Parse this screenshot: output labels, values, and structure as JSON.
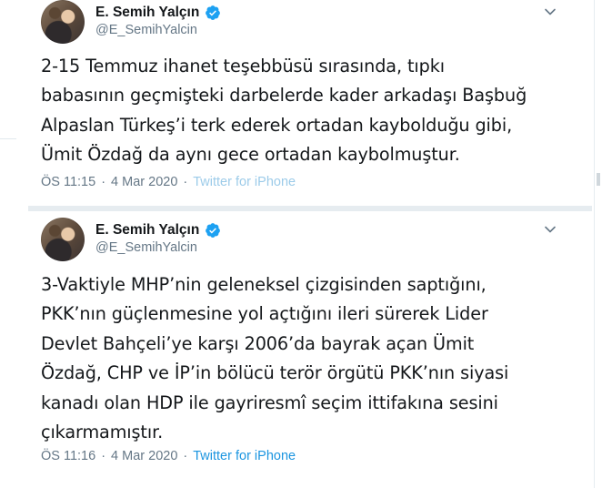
{
  "tweets": [
    {
      "author": {
        "display_name": "E. Semih Yalçın",
        "handle": "@E_SemihYalcin",
        "verified": true
      },
      "text": "2-15 Temmuz ihanet teşebbüsü sırasında, tıpkı\nbabasının geçmişteki darbelerde kader arkadaşı Başbuğ\nAlpaslan Türkeş’i terk ederek ortadan kaybolduğu gibi,\nÜmit Özdağ da aynı gece ortadan kaybolmuştur.",
      "time": "ÖS 11:15",
      "date": "4 Mar 2020",
      "separator": "·",
      "source": "Twitter for iPhone"
    },
    {
      "author": {
        "display_name": "E. Semih Yalçın",
        "handle": "@E_SemihYalcin",
        "verified": true
      },
      "text": "3-Vaktiyle MHP’nin geleneksel çizgisinden saptığını,\nPKK’nın güçlenmesine yol açtığını ileri sürerek Lider\nDevlet Bahçeli’ye karşı 2006’da bayrak açan Ümit\nÖzdağ, CHP ve İP’in bölücü terör örgütü PKK’nın siyasi\nkanadı olan HDP ile gayriresmî seçim ittifakına sesini\nçıkarmamıştır.",
      "time": "ÖS 11:16",
      "date": "4 Mar 2020",
      "separator": "·",
      "source": "Twitter for iPhone"
    }
  ],
  "colors": {
    "verified_badge": "#1da1f2",
    "link": "#1b95e0",
    "secondary_text": "#657786",
    "divider": "#e6ecf0"
  }
}
